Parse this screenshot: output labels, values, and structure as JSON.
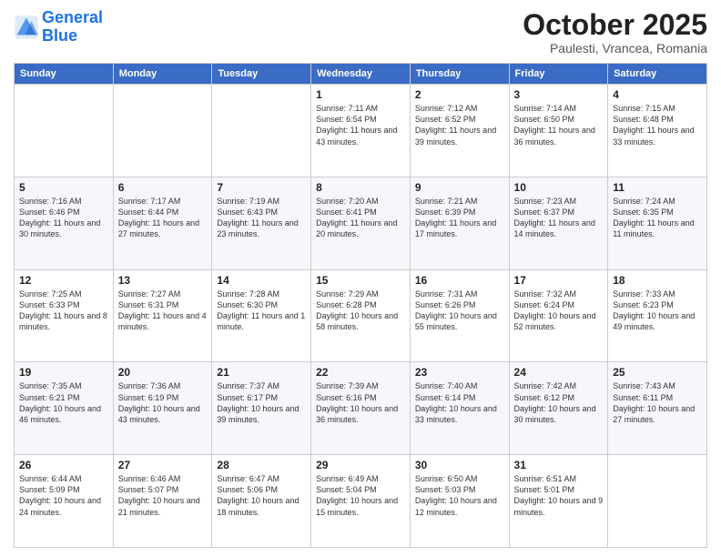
{
  "header": {
    "logo_line1": "General",
    "logo_line2": "Blue",
    "month": "October 2025",
    "location": "Paulesti, Vrancea, Romania"
  },
  "days_of_week": [
    "Sunday",
    "Monday",
    "Tuesday",
    "Wednesday",
    "Thursday",
    "Friday",
    "Saturday"
  ],
  "weeks": [
    [
      {
        "day": "",
        "info": ""
      },
      {
        "day": "",
        "info": ""
      },
      {
        "day": "",
        "info": ""
      },
      {
        "day": "1",
        "info": "Sunrise: 7:11 AM\nSunset: 6:54 PM\nDaylight: 11 hours and 43 minutes."
      },
      {
        "day": "2",
        "info": "Sunrise: 7:12 AM\nSunset: 6:52 PM\nDaylight: 11 hours and 39 minutes."
      },
      {
        "day": "3",
        "info": "Sunrise: 7:14 AM\nSunset: 6:50 PM\nDaylight: 11 hours and 36 minutes."
      },
      {
        "day": "4",
        "info": "Sunrise: 7:15 AM\nSunset: 6:48 PM\nDaylight: 11 hours and 33 minutes."
      }
    ],
    [
      {
        "day": "5",
        "info": "Sunrise: 7:16 AM\nSunset: 6:46 PM\nDaylight: 11 hours and 30 minutes."
      },
      {
        "day": "6",
        "info": "Sunrise: 7:17 AM\nSunset: 6:44 PM\nDaylight: 11 hours and 27 minutes."
      },
      {
        "day": "7",
        "info": "Sunrise: 7:19 AM\nSunset: 6:43 PM\nDaylight: 11 hours and 23 minutes."
      },
      {
        "day": "8",
        "info": "Sunrise: 7:20 AM\nSunset: 6:41 PM\nDaylight: 11 hours and 20 minutes."
      },
      {
        "day": "9",
        "info": "Sunrise: 7:21 AM\nSunset: 6:39 PM\nDaylight: 11 hours and 17 minutes."
      },
      {
        "day": "10",
        "info": "Sunrise: 7:23 AM\nSunset: 6:37 PM\nDaylight: 11 hours and 14 minutes."
      },
      {
        "day": "11",
        "info": "Sunrise: 7:24 AM\nSunset: 6:35 PM\nDaylight: 11 hours and 11 minutes."
      }
    ],
    [
      {
        "day": "12",
        "info": "Sunrise: 7:25 AM\nSunset: 6:33 PM\nDaylight: 11 hours and 8 minutes."
      },
      {
        "day": "13",
        "info": "Sunrise: 7:27 AM\nSunset: 6:31 PM\nDaylight: 11 hours and 4 minutes."
      },
      {
        "day": "14",
        "info": "Sunrise: 7:28 AM\nSunset: 6:30 PM\nDaylight: 11 hours and 1 minute."
      },
      {
        "day": "15",
        "info": "Sunrise: 7:29 AM\nSunset: 6:28 PM\nDaylight: 10 hours and 58 minutes."
      },
      {
        "day": "16",
        "info": "Sunrise: 7:31 AM\nSunset: 6:26 PM\nDaylight: 10 hours and 55 minutes."
      },
      {
        "day": "17",
        "info": "Sunrise: 7:32 AM\nSunset: 6:24 PM\nDaylight: 10 hours and 52 minutes."
      },
      {
        "day": "18",
        "info": "Sunrise: 7:33 AM\nSunset: 6:23 PM\nDaylight: 10 hours and 49 minutes."
      }
    ],
    [
      {
        "day": "19",
        "info": "Sunrise: 7:35 AM\nSunset: 6:21 PM\nDaylight: 10 hours and 46 minutes."
      },
      {
        "day": "20",
        "info": "Sunrise: 7:36 AM\nSunset: 6:19 PM\nDaylight: 10 hours and 43 minutes."
      },
      {
        "day": "21",
        "info": "Sunrise: 7:37 AM\nSunset: 6:17 PM\nDaylight: 10 hours and 39 minutes."
      },
      {
        "day": "22",
        "info": "Sunrise: 7:39 AM\nSunset: 6:16 PM\nDaylight: 10 hours and 36 minutes."
      },
      {
        "day": "23",
        "info": "Sunrise: 7:40 AM\nSunset: 6:14 PM\nDaylight: 10 hours and 33 minutes."
      },
      {
        "day": "24",
        "info": "Sunrise: 7:42 AM\nSunset: 6:12 PM\nDaylight: 10 hours and 30 minutes."
      },
      {
        "day": "25",
        "info": "Sunrise: 7:43 AM\nSunset: 6:11 PM\nDaylight: 10 hours and 27 minutes."
      }
    ],
    [
      {
        "day": "26",
        "info": "Sunrise: 6:44 AM\nSunset: 5:09 PM\nDaylight: 10 hours and 24 minutes."
      },
      {
        "day": "27",
        "info": "Sunrise: 6:46 AM\nSunset: 5:07 PM\nDaylight: 10 hours and 21 minutes."
      },
      {
        "day": "28",
        "info": "Sunrise: 6:47 AM\nSunset: 5:06 PM\nDaylight: 10 hours and 18 minutes."
      },
      {
        "day": "29",
        "info": "Sunrise: 6:49 AM\nSunset: 5:04 PM\nDaylight: 10 hours and 15 minutes."
      },
      {
        "day": "30",
        "info": "Sunrise: 6:50 AM\nSunset: 5:03 PM\nDaylight: 10 hours and 12 minutes."
      },
      {
        "day": "31",
        "info": "Sunrise: 6:51 AM\nSunset: 5:01 PM\nDaylight: 10 hours and 9 minutes."
      },
      {
        "day": "",
        "info": ""
      }
    ]
  ]
}
